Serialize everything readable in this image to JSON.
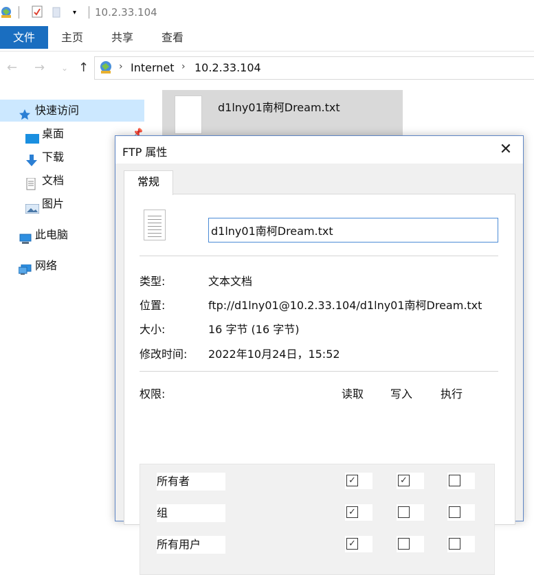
{
  "titlebar": {
    "title": "10.2.33.104"
  },
  "ribbon": {
    "tabs": [
      "文件",
      "主页",
      "共享",
      "查看"
    ]
  },
  "address": {
    "crumbs": [
      "Internet",
      "10.2.33.104"
    ]
  },
  "navpane": {
    "items": [
      {
        "label": "快速访问",
        "icon": "star-icon"
      },
      {
        "label": "桌面",
        "icon": "desktop-icon"
      },
      {
        "label": "下载",
        "icon": "download-icon"
      },
      {
        "label": "文档",
        "icon": "documents-icon"
      },
      {
        "label": "图片",
        "icon": "pictures-icon"
      },
      {
        "label": "此电脑",
        "icon": "computer-icon"
      },
      {
        "label": "网络",
        "icon": "network-icon"
      }
    ]
  },
  "content": {
    "file_name": "d1lny01南柯Dream.txt"
  },
  "dialog": {
    "title": "FTP 属性",
    "tab": "常规",
    "file_name": "d1lny01南柯Dream.txt",
    "properties": [
      {
        "label": "类型:",
        "value": "文本文档"
      },
      {
        "label": "位置:",
        "value": "ftp://d1lny01@10.2.33.104/d1lny01南柯Dream.txt"
      },
      {
        "label": "大小:",
        "value": "16 字节 (16 字节)"
      },
      {
        "label": "修改时间:",
        "value": "2022年10月24日，15:52"
      }
    ],
    "permissions": {
      "label": "权限:",
      "columns": [
        "读取",
        "写入",
        "执行"
      ],
      "rows": [
        {
          "who": "所有者",
          "read": true,
          "write": true,
          "exec": false
        },
        {
          "who": "组",
          "read": true,
          "write": false,
          "exec": false
        },
        {
          "who": "所有用户",
          "read": true,
          "write": false,
          "exec": false
        }
      ]
    }
  }
}
